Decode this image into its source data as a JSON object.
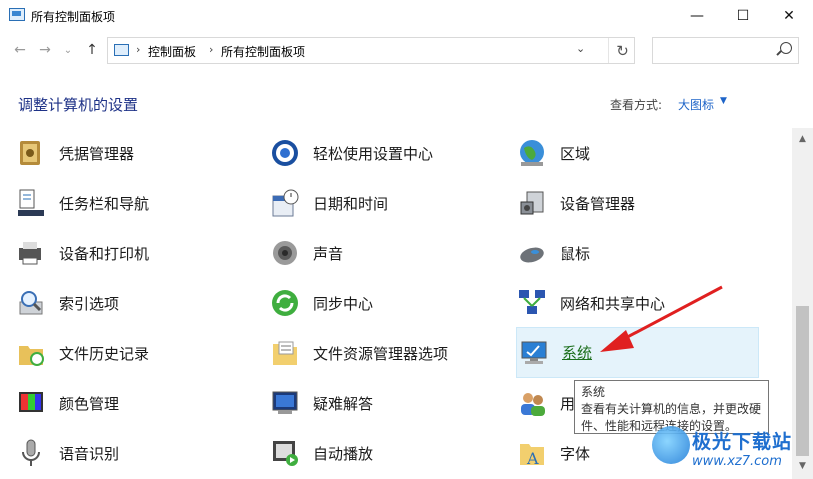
{
  "window": {
    "title": "所有控制面板项",
    "controls": {
      "minimize": "—",
      "maximize": "☐",
      "close": "✕"
    }
  },
  "nav": {
    "back": "←",
    "forward": "→",
    "dropdown": "⌄",
    "up": "↑"
  },
  "address": {
    "crumbs": [
      "控制面板",
      "所有控制面板项"
    ],
    "separator": "›",
    "dropdown": "⌄",
    "refresh": "↻"
  },
  "search": {
    "placeholder": ""
  },
  "header": {
    "title": "调整计算机的设置",
    "view_by_label": "查看方式:",
    "view_by_value": "大图标",
    "view_by_caret": "▼"
  },
  "items": [
    {
      "label": "凭据管理器",
      "icon": "credential-manager-icon"
    },
    {
      "label": "轻松使用设置中心",
      "icon": "ease-of-access-icon"
    },
    {
      "label": "区域",
      "icon": "region-globe-icon"
    },
    {
      "label": "任务栏和导航",
      "icon": "taskbar-icon"
    },
    {
      "label": "日期和时间",
      "icon": "date-time-icon"
    },
    {
      "label": "设备管理器",
      "icon": "device-manager-icon"
    },
    {
      "label": "设备和打印机",
      "icon": "printer-icon"
    },
    {
      "label": "声音",
      "icon": "speaker-icon"
    },
    {
      "label": "鼠标",
      "icon": "mouse-icon"
    },
    {
      "label": "索引选项",
      "icon": "indexing-icon"
    },
    {
      "label": "同步中心",
      "icon": "sync-icon"
    },
    {
      "label": "网络和共享中心",
      "icon": "network-icon"
    },
    {
      "label": "文件历史记录",
      "icon": "file-history-icon"
    },
    {
      "label": "文件资源管理器选项",
      "icon": "folder-options-icon"
    },
    {
      "label": "系统",
      "icon": "system-icon"
    },
    {
      "label": "颜色管理",
      "icon": "color-management-icon"
    },
    {
      "label": "疑难解答",
      "icon": "troubleshooting-icon"
    },
    {
      "label": "用",
      "icon": "user-accounts-icon"
    },
    {
      "label": "语音识别",
      "icon": "microphone-icon"
    },
    {
      "label": "自动播放",
      "icon": "autoplay-icon"
    },
    {
      "label": "字体",
      "icon": "fonts-icon"
    }
  ],
  "tooltip": {
    "title": "系统",
    "line1": "查看有关计算机的信息，并更改硬",
    "line2": "件、性能和远程连接的设置。"
  },
  "scrollbar": {
    "up": "▲",
    "down": "▼"
  },
  "watermark": {
    "text": "极光下载站",
    "url": "www.xz7.com"
  },
  "colors": {
    "heading": "#1e3287",
    "link": "#1e64c8",
    "hover_bg": "#e5f3fb",
    "arrow": "#e02020"
  }
}
